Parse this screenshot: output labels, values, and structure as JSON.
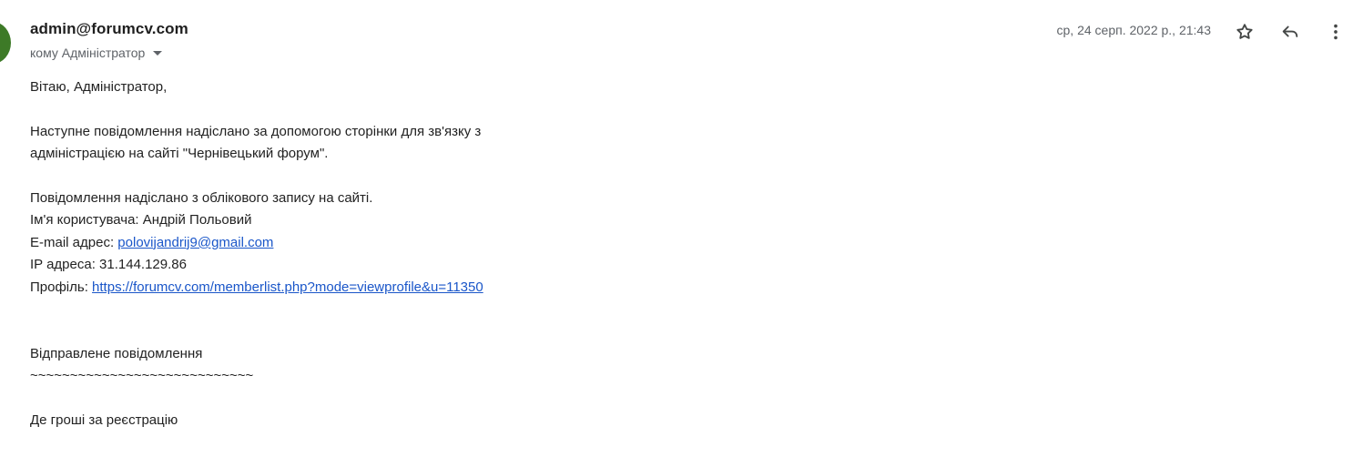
{
  "header": {
    "sender": "admin@forumcv.com",
    "recipient_prefix": "кому",
    "recipient": "Адміністратор",
    "date": "ср, 24 серп. 2022 р., 21:43"
  },
  "actions": {
    "star_icon": "star-outline-icon",
    "reply_icon": "reply-arrow-icon",
    "more_icon": "vertical-dots-icon"
  },
  "body": {
    "greeting": "Вітаю, Адміністратор,",
    "intro_line1": "Наступне повідомлення надіслано за допомогою сторінки для зв'язку з",
    "intro_line2": "адміністрацією на сайті \"Чернівецький форум\".",
    "account_note": "Повідомлення надіслано з облікового запису на сайті.",
    "username_label": "Ім'я користувача:",
    "username": "Андрій Польовий",
    "email_label": "E-mail адрес:",
    "email": "polovijandrij9@gmail.com",
    "ip_label": "IP адреса:",
    "ip": "31.144.129.86",
    "profile_label": "Профіль:",
    "profile_url": "https://forumcv.com/memberlist.php?mode=viewprofile&u=11350",
    "sent_message_heading": "Відправлене повідомлення",
    "separator": "~~~~~~~~~~~~~~~~~~~~~~~~~~~~",
    "message": "Де гроші за реєстрацію"
  },
  "colors": {
    "avatar": "#3d7a27",
    "link": "#1a56c9",
    "muted": "#5f6368"
  }
}
